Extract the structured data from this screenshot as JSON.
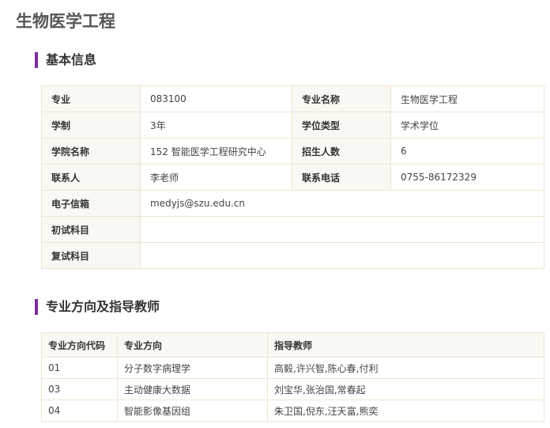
{
  "page_title": "生物医学工程",
  "sections": {
    "basic_info": "基本信息",
    "directions": "专业方向及指导教师"
  },
  "basic_info": {
    "major_code_label": "专业",
    "major_code": "083100",
    "major_name_label": "专业名称",
    "major_name": "生物医学工程",
    "duration_label": "学制",
    "duration": "3年",
    "degree_type_label": "学位类型",
    "degree_type": "学术学位",
    "college_label": "学院名称",
    "college": "152 智能医学工程研究中心",
    "enrollment_label": "招生人数",
    "enrollment": "6",
    "contact_label": "联系人",
    "contact": "李老师",
    "phone_label": "联系电话",
    "phone": "0755-86172329",
    "email_label": "电子信箱",
    "email": "medyjs@szu.edu.cn",
    "initial_exam_label": "初试科目",
    "initial_exam": "",
    "retest_label": "复试科目",
    "retest": ""
  },
  "directions": {
    "headers": [
      "专业方向代码",
      "专业方向",
      "指导教师"
    ],
    "rows": [
      {
        "code": "01",
        "name": "分子数字病理学",
        "advisors": "高毅,许兴智,陈心春,付利"
      },
      {
        "code": "03",
        "name": "主动健康大数据",
        "advisors": "刘宝华,张治国,常春起"
      },
      {
        "code": "04",
        "name": "智能影像基因组",
        "advisors": "朱卫国,倪东,汪天富,熊奕"
      }
    ]
  }
}
